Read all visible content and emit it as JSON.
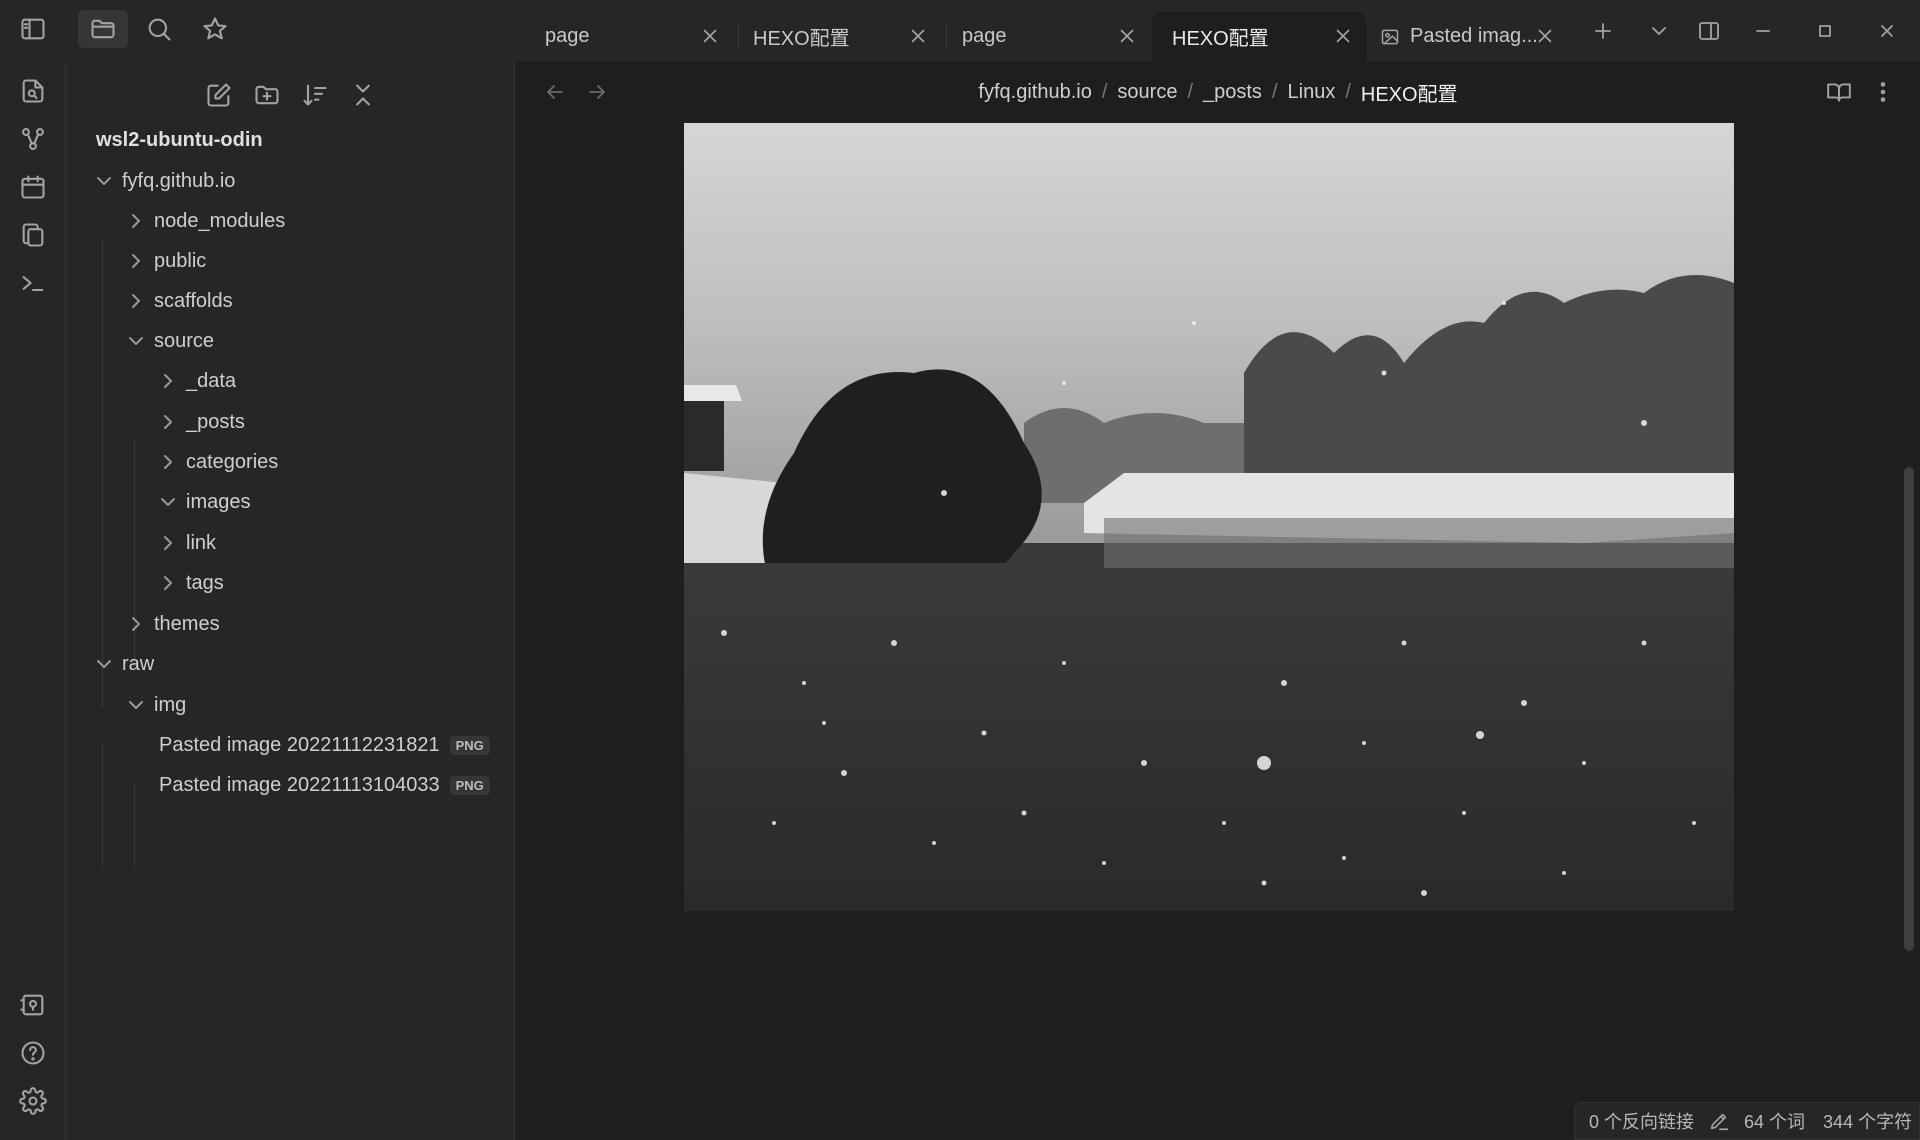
{
  "titlebar": {
    "tabs": [
      {
        "label": "page",
        "active": false,
        "icon": null
      },
      {
        "label": "HEXO配置",
        "active": false,
        "icon": null
      },
      {
        "label": "page",
        "active": false,
        "icon": null
      },
      {
        "label": "HEXO配置",
        "active": true,
        "icon": null
      },
      {
        "label": "Pasted imag...",
        "active": false,
        "icon": "image-icon"
      }
    ],
    "icons": [
      "sidebar-toggle-icon",
      "folder-icon",
      "search-icon",
      "star-icon",
      "plus-icon",
      "chevron-down-icon",
      "split-view-icon",
      "minimize-icon",
      "maximize-icon",
      "close-icon"
    ]
  },
  "ribbon": {
    "top_icons": [
      "quick-switcher-icon",
      "graph-icon",
      "calendar-icon",
      "copy-icon",
      "terminal-icon"
    ],
    "bottom_icons": [
      "vault-icon",
      "help-icon",
      "settings-icon"
    ]
  },
  "sidebar": {
    "actions": [
      "new-note-icon",
      "new-folder-icon",
      "sort-icon",
      "collapse-all-icon"
    ],
    "vault_name": "wsl2-ubuntu-odin",
    "tree": [
      {
        "label": "fyfq.github.io",
        "expanded": true
      },
      {
        "label": "node_modules",
        "expanded": false
      },
      {
        "label": "public",
        "expanded": false
      },
      {
        "label": "scaffolds",
        "expanded": false
      },
      {
        "label": "source",
        "expanded": true
      },
      {
        "label": "_data",
        "expanded": false
      },
      {
        "label": "_posts",
        "expanded": false
      },
      {
        "label": "categories",
        "expanded": false
      },
      {
        "label": "images",
        "expanded": true
      },
      {
        "label": "link",
        "expanded": false
      },
      {
        "label": "tags",
        "expanded": false
      },
      {
        "label": "themes",
        "expanded": false
      },
      {
        "label": "raw",
        "expanded": true
      },
      {
        "label": "img",
        "expanded": true
      },
      {
        "label": "Pasted image 20221112231821",
        "badge": "PNG"
      },
      {
        "label": "Pasted image 20221113104033",
        "badge": "PNG"
      }
    ]
  },
  "main": {
    "breadcrumb": [
      "fyfq.github.io",
      "source",
      "_posts",
      "Linux",
      "HEXO配置"
    ],
    "separator": "/",
    "image": {
      "subject": "snowy lake landscape",
      "tone": "black-and-white"
    }
  },
  "statusbar": {
    "backlinks": "0 个反向链接",
    "words": "64 个词",
    "chars": "344 个字符"
  },
  "colors": {
    "background": "#1e1e1e",
    "panel": "#262626",
    "text": "#dcddde",
    "muted": "#a3a3a3"
  }
}
